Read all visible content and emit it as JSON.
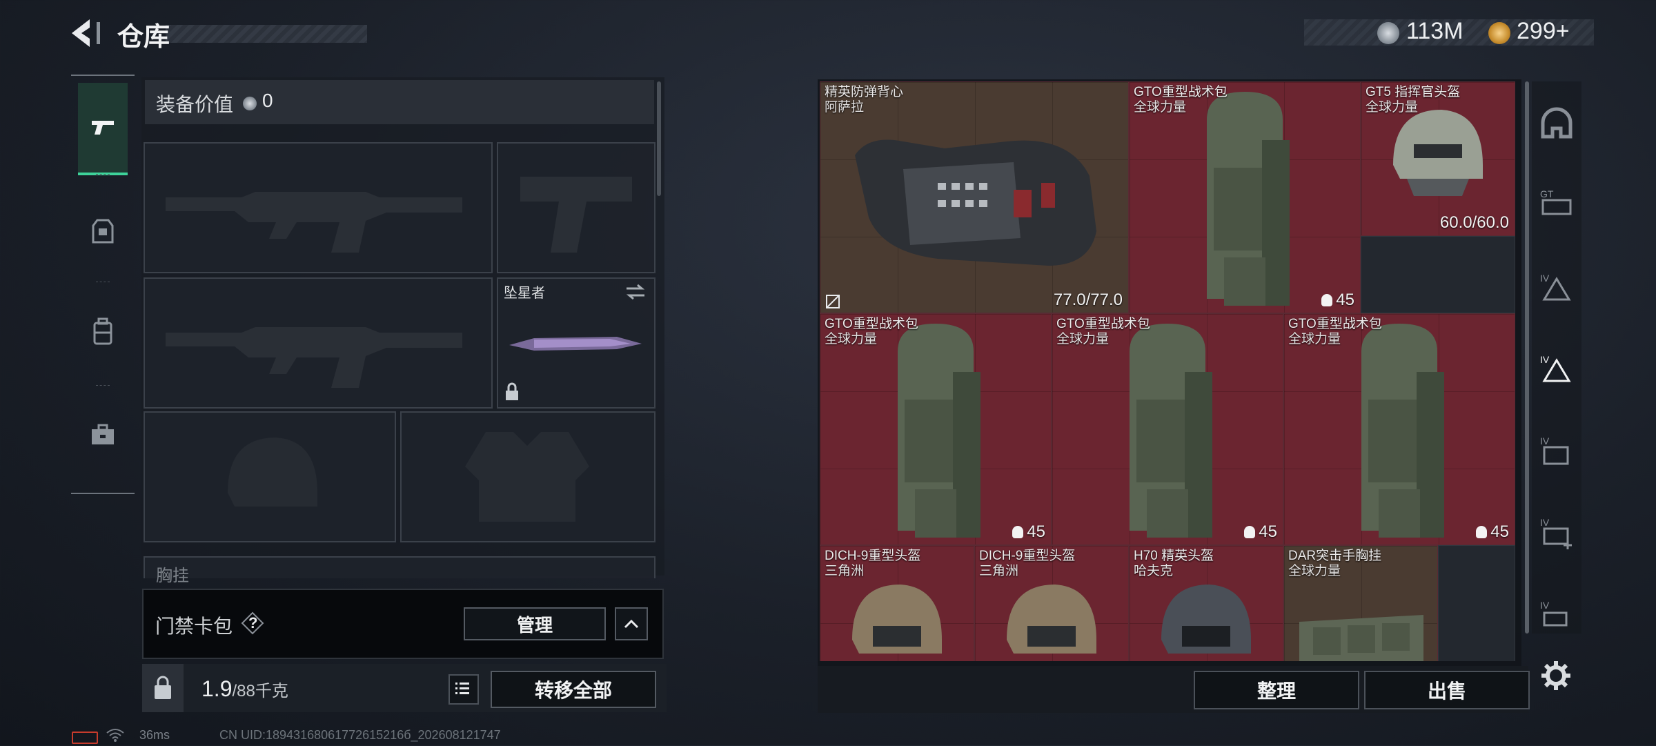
{
  "header": {
    "title": "仓库",
    "money": "113M",
    "gold": "299+"
  },
  "loadout": {
    "value_label": "装备价值",
    "value": "0",
    "knife_name": "坠星者",
    "chest_label": "胸挂",
    "keycard_label": "门禁卡包",
    "keycard_help": "?",
    "manage_label": "管理",
    "weight_current": "1.9",
    "weight_max": "/88千克",
    "transfer_all_label": "转移全部"
  },
  "tabs": [
    {
      "name": "weapons",
      "active": true
    },
    {
      "name": "armor",
      "active": false
    },
    {
      "name": "backpack",
      "active": false
    },
    {
      "name": "supplies",
      "active": false
    }
  ],
  "stash": {
    "items": [
      {
        "name": "精英防弹背心",
        "sub": "阿萨拉",
        "value": "77.0/77.0",
        "bg": "brown"
      },
      {
        "name": "GTO重型战术包",
        "sub": "全球力量",
        "value": "45",
        "bg": "red"
      },
      {
        "name": "GT5 指挥官头盔",
        "sub": "全球力量",
        "value": "60.0/60.0",
        "bg": "red"
      },
      {
        "name": "GTO重型战术包",
        "sub": "全球力量",
        "value": "45",
        "bg": "red"
      },
      {
        "name": "GTO重型战术包",
        "sub": "全球力量",
        "value": "45",
        "bg": "red"
      },
      {
        "name": "GTO重型战术包",
        "sub": "全球力量",
        "value": "45",
        "bg": "red"
      },
      {
        "name": "DICH-9重型头盔",
        "sub": "三角洲",
        "value": "",
        "bg": "red"
      },
      {
        "name": "DICH-9重型头盔",
        "sub": "三角洲",
        "value": "",
        "bg": "red"
      },
      {
        "name": "H70 精英头盔",
        "sub": "哈夫克",
        "value": "",
        "bg": "red"
      },
      {
        "name": "DAR突击手胸挂",
        "sub": "全球力量",
        "value": "",
        "bg": "brown"
      }
    ],
    "sort_label": "整理",
    "sell_label": "出售",
    "categories": [
      "helmet-icon",
      "gt-vest-icon",
      "iv-armor-icon",
      "iv-armor-selected-icon",
      "iv-backpack-icon",
      "iv-medkit-icon",
      "iv-misc-icon"
    ]
  },
  "status": {
    "ping": "36ms",
    "uid": "CN UID:18943168061772615216б_202608121747"
  },
  "colors": {
    "accent": "#3ed39a",
    "item_red": "#6b2530",
    "item_brown": "#4a3b31"
  }
}
